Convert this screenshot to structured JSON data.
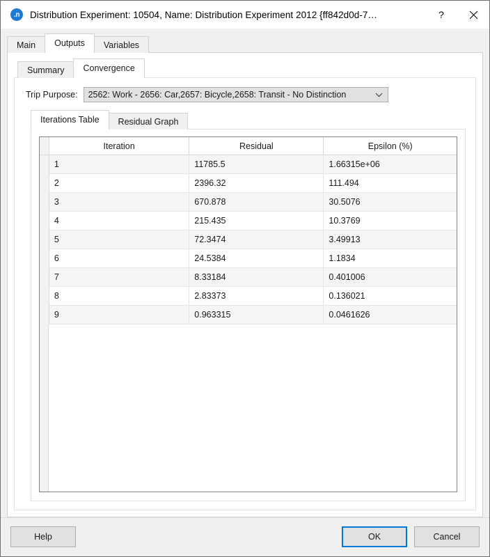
{
  "window": {
    "icon_label": ".n",
    "title": "Distribution Experiment: 10504, Name: Distribution Experiment 2012  {ff842d0d-7…",
    "help_glyph": "?",
    "close_name": "close-icon"
  },
  "outer_tabs": [
    {
      "label": "Main",
      "selected": false
    },
    {
      "label": "Outputs",
      "selected": true
    },
    {
      "label": "Variables",
      "selected": false
    }
  ],
  "inner_tabs": [
    {
      "label": "Summary",
      "selected": false
    },
    {
      "label": "Convergence",
      "selected": true
    }
  ],
  "trip_purpose": {
    "label": "Trip Purpose:",
    "value": "2562: Work - 2656: Car,2657: Bicycle,2658: Transit - No Distinction",
    "arrow": "chevron-down-icon"
  },
  "table_tabs": [
    {
      "label": "Iterations Table",
      "selected": true
    },
    {
      "label": "Residual Graph",
      "selected": false
    }
  ],
  "table": {
    "columns": [
      "Iteration",
      "Residual",
      "Epsilon (%)"
    ],
    "rows": [
      [
        "1",
        "11785.5",
        "1.66315e+06"
      ],
      [
        "2",
        "2396.32",
        "111.494"
      ],
      [
        "3",
        "670.878",
        "30.5076"
      ],
      [
        "4",
        "215.435",
        "10.3769"
      ],
      [
        "5",
        "72.3474",
        "3.49913"
      ],
      [
        "6",
        "24.5384",
        "1.1834"
      ],
      [
        "7",
        "8.33184",
        "0.401006"
      ],
      [
        "8",
        "2.83373",
        "0.136021"
      ],
      [
        "9",
        "0.963315",
        "0.0461626"
      ]
    ]
  },
  "footer": {
    "help_label": "Help",
    "ok_label": "OK",
    "cancel_label": "Cancel",
    "focus_color": "#0078d7"
  }
}
